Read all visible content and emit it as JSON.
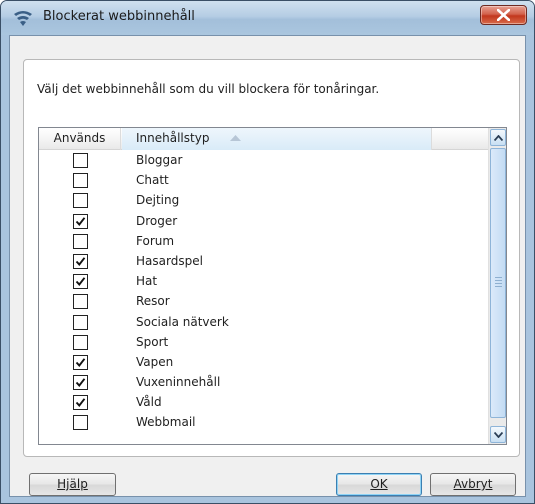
{
  "window": {
    "title": "Blockerat webbinnehåll"
  },
  "instruction": "Välj det webbinnehåll som du vill blockera för tonåringar.",
  "list": {
    "columns": [
      "Används",
      "Innehållstyp"
    ],
    "sort": "ascending",
    "rows": [
      {
        "label": "Bloggar",
        "checked": false
      },
      {
        "label": "Chatt",
        "checked": false
      },
      {
        "label": "Dejting",
        "checked": false
      },
      {
        "label": "Droger",
        "checked": true
      },
      {
        "label": "Forum",
        "checked": false
      },
      {
        "label": "Hasardspel",
        "checked": true
      },
      {
        "label": "Hat",
        "checked": true
      },
      {
        "label": "Resor",
        "checked": false
      },
      {
        "label": "Sociala nätverk",
        "checked": false
      },
      {
        "label": "Sport",
        "checked": false
      },
      {
        "label": "Vapen",
        "checked": true
      },
      {
        "label": "Vuxeninnehåll",
        "checked": true
      },
      {
        "label": "Våld",
        "checked": true
      },
      {
        "label": "Webbmail",
        "checked": false
      }
    ]
  },
  "buttons": {
    "help": "Hjälp",
    "ok": "OK",
    "cancel": "Avbryt"
  },
  "icons": {
    "app": "wifi-shield-icon",
    "close": "close-icon"
  },
  "colors": {
    "titlebar": "#b5cde4",
    "close": "#c2371d",
    "accent": "#3c7fb1"
  }
}
